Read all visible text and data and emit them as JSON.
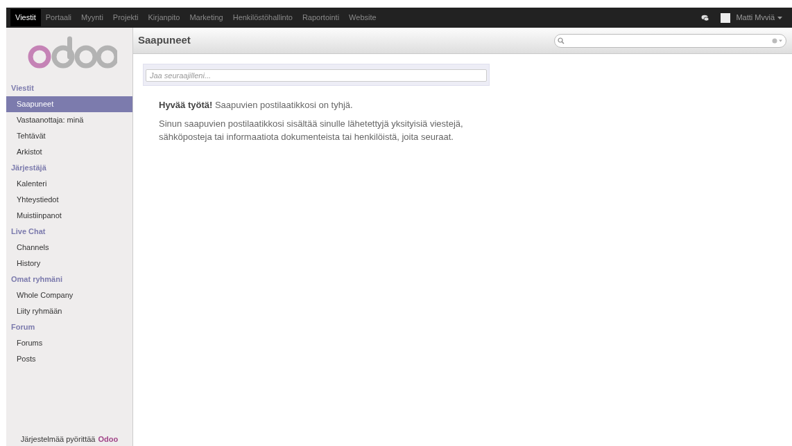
{
  "top_menu": [
    {
      "label": "Viestit",
      "selected": true
    },
    {
      "label": "Portaali",
      "selected": false
    },
    {
      "label": "Myynti",
      "selected": false
    },
    {
      "label": "Projekti",
      "selected": false
    },
    {
      "label": "Kirjanpito",
      "selected": false
    },
    {
      "label": "Marketing",
      "selected": false
    },
    {
      "label": "Henkilöstöhallinto",
      "selected": false
    },
    {
      "label": "Raportointi",
      "selected": false
    },
    {
      "label": "Website",
      "selected": false
    }
  ],
  "user": {
    "name": "Matti Mvviä"
  },
  "sidebar": {
    "sections": [
      {
        "title": "Viestit",
        "items": [
          {
            "label": "Saapuneet",
            "selected": true
          },
          {
            "label": "Vastaanottaja: minä",
            "selected": false
          },
          {
            "label": "Tehtävät",
            "selected": false
          },
          {
            "label": "Arkistot",
            "selected": false
          }
        ]
      },
      {
        "title": "Järjestäjä",
        "items": [
          {
            "label": "Kalenteri",
            "selected": false
          },
          {
            "label": "Yhteystiedot",
            "selected": false
          },
          {
            "label": "Muistiinpanot",
            "selected": false
          }
        ]
      },
      {
        "title": "Live Chat",
        "items": [
          {
            "label": "Channels",
            "selected": false
          },
          {
            "label": "History",
            "selected": false
          }
        ]
      },
      {
        "title": "Omat ryhmäni",
        "items": [
          {
            "label": "Whole Company",
            "selected": false
          },
          {
            "label": "Liity ryhmään",
            "selected": false
          }
        ]
      },
      {
        "title": "Forum",
        "items": [
          {
            "label": "Forums",
            "selected": false
          },
          {
            "label": "Posts",
            "selected": false
          }
        ]
      }
    ],
    "footer_text": "Järjestelmää pyörittää",
    "footer_link": "Odoo"
  },
  "page": {
    "title": "Saapuneet",
    "share_placeholder": "Jaa seuraajilleni...",
    "empty_message": "**Hyvää työtä!** Saapuvien postilaatikkosi on tyhjä.",
    "empty_help": "Sinun saapuvien postilaatikkosi sisältää sinulle lähetettyjä yksityisiä viestejä, sähköposteja tai informaatiota dokumenteista tai henkilöistä, joita seuraat."
  }
}
